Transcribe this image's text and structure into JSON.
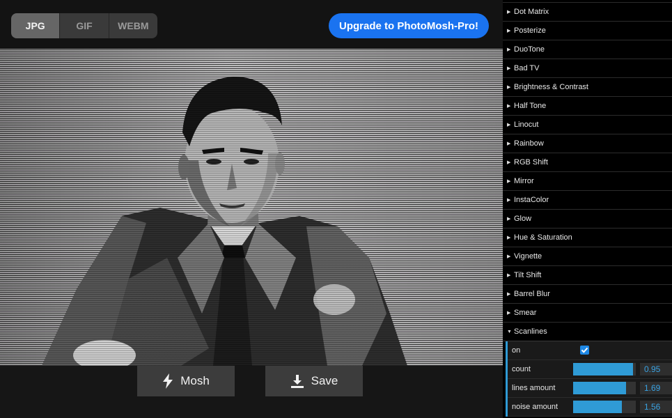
{
  "formats": [
    {
      "label": "JPG",
      "active": true
    },
    {
      "label": "GIF",
      "active": false
    },
    {
      "label": "WEBM",
      "active": false
    }
  ],
  "upgrade_label": "Upgrade to PhotoMosh-Pro!",
  "actions": {
    "mosh_label": "Mosh",
    "save_label": "Save",
    "mosh_icon": "lightning-icon",
    "save_icon": "download-icon"
  },
  "effects": [
    "Dot Matrix",
    "Posterize",
    "DuoTone",
    "Bad TV",
    "Brightness & Contrast",
    "Half Tone",
    "Linocut",
    "Rainbow",
    "RGB Shift",
    "Mirror",
    "InstaColor",
    "Glow",
    "Hue & Saturation",
    "Vignette",
    "Tilt Shift",
    "Barrel Blur",
    "Smear"
  ],
  "open_effect": {
    "label": "Scanlines",
    "on_label": "on",
    "on_checked": true,
    "sliders": [
      {
        "label": "count",
        "value": "0.95",
        "fill_fraction": 0.95
      },
      {
        "label": "lines amount",
        "value": "1.69",
        "fill_fraction": 0.84
      },
      {
        "label": "noise amount",
        "value": "1.56",
        "fill_fraction": 0.78
      }
    ]
  },
  "colors": {
    "accent": "#2f9bd6",
    "upgrade": "#1a73f0",
    "checkbox": "#1e88e5"
  }
}
